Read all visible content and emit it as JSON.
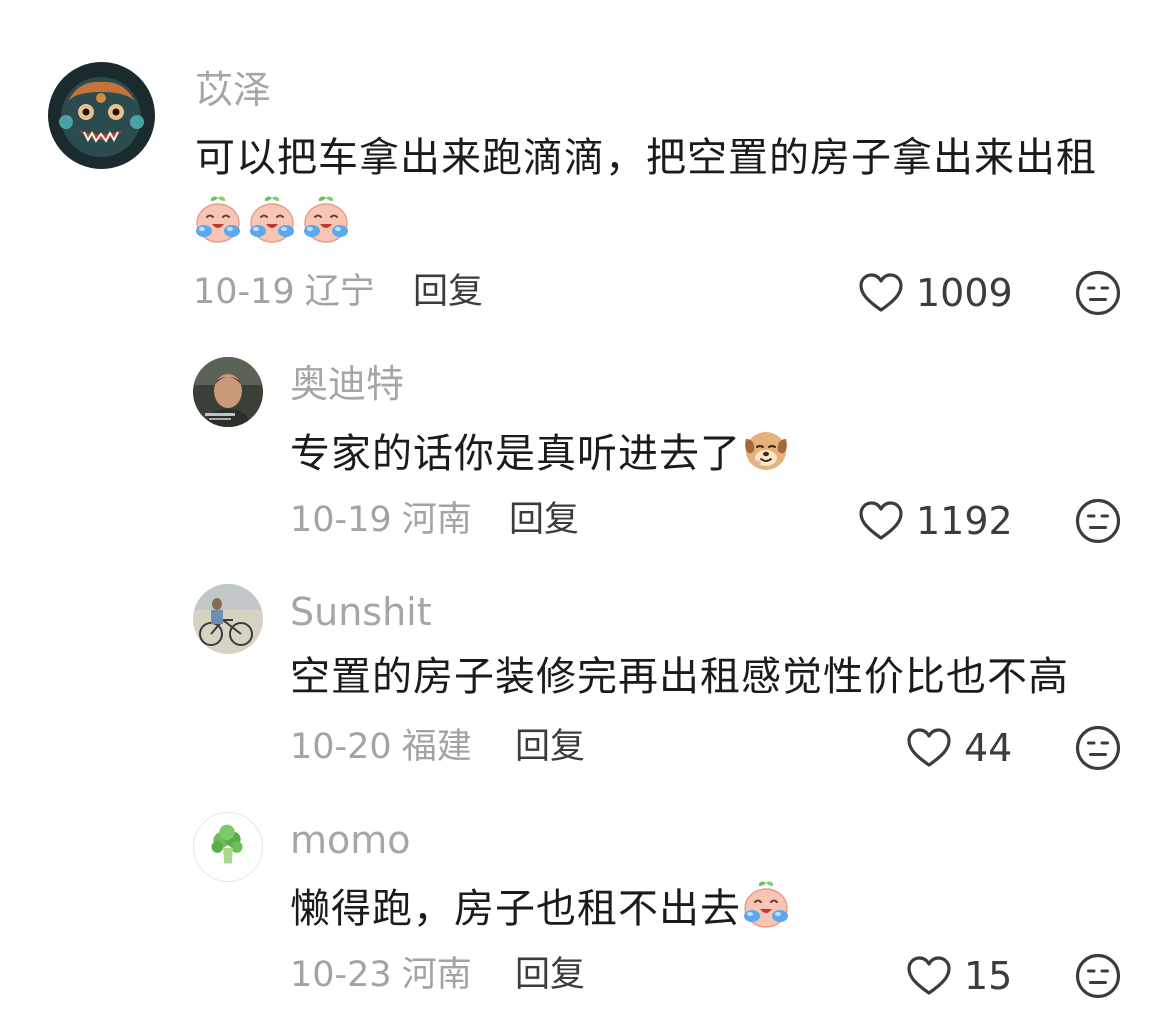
{
  "comments": [
    {
      "username": "苡泽",
      "text": "可以把车拿出来跑滴滴，把空置的房子拿出来出租",
      "emoji_line": [
        "crying-peach-emoji",
        "crying-peach-emoji",
        "crying-peach-emoji"
      ],
      "date": "10-19",
      "location": "辽宁",
      "reply_label": "回复",
      "likes": "1009",
      "avatar": "dragon-avatar"
    },
    {
      "username": "奥迪特",
      "text": "专家的话你是真听进去了",
      "trailing_emoji": "dog-emoji",
      "date": "10-19",
      "location": "河南",
      "reply_label": "回复",
      "likes": "1192",
      "avatar": "man-photo-avatar"
    },
    {
      "username": "Sunshit",
      "text": "空置的房子装修完再出租感觉性价比也不高",
      "date": "10-20",
      "location": "福建",
      "reply_label": "回复",
      "likes": "44",
      "avatar": "bicycle-photo-avatar"
    },
    {
      "username": "momo",
      "text": "懒得跑，房子也租不出去",
      "trailing_emoji": "crying-peach-emoji",
      "date": "10-23",
      "location": "河南",
      "reply_label": "回复",
      "likes": "15",
      "avatar": "broccoli-avatar"
    }
  ],
  "colors": {
    "username": "#a6a6a6",
    "text": "#1b1b1b",
    "meta": "#a3a3a3",
    "icon": "#3c3c3c"
  }
}
